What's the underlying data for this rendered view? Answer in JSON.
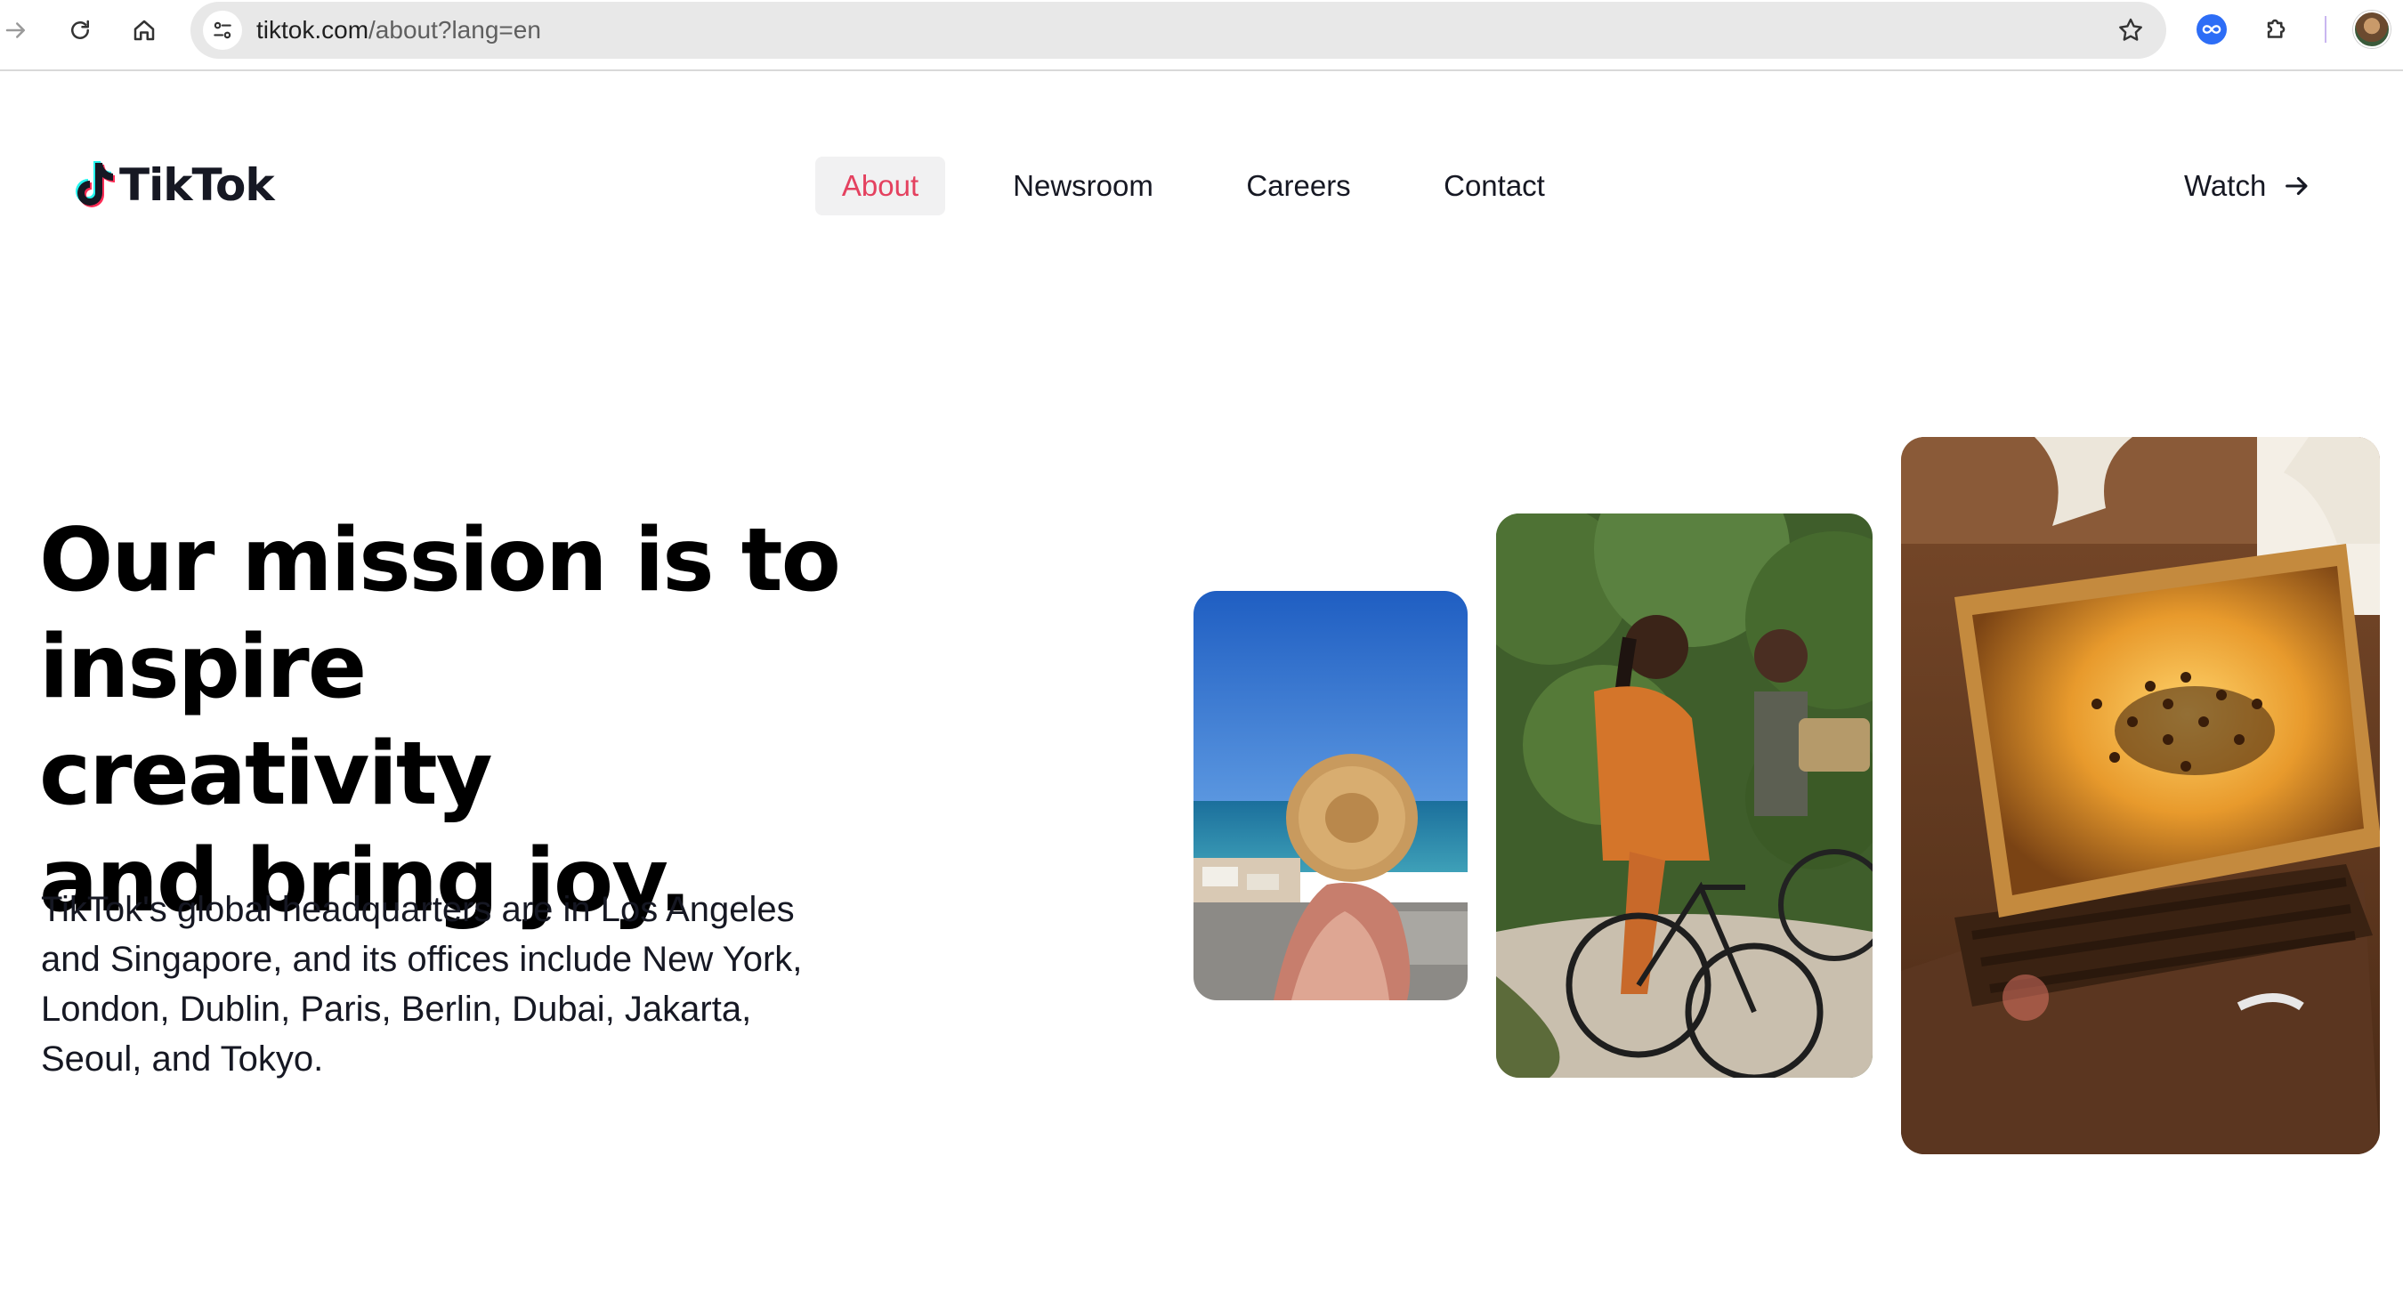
{
  "browser": {
    "url_host": "tiktok.com",
    "url_path": "/about?lang=en",
    "icons": {
      "forward": "arrow-right-icon",
      "reload": "reload-icon",
      "home": "home-icon",
      "site_info": "tune-icon",
      "bookmark": "star-icon",
      "extension": "infinity-icon",
      "extensions_menu": "puzzle-icon"
    }
  },
  "header": {
    "logo_text": "TikTok",
    "nav": [
      {
        "label": "About",
        "active": true
      },
      {
        "label": "Newsroom",
        "active": false
      },
      {
        "label": "Careers",
        "active": false
      },
      {
        "label": "Contact",
        "active": false
      }
    ],
    "watch_label": "Watch"
  },
  "hero": {
    "title_line1": "Our mission is to",
    "title_line2": "inspire creativity",
    "title_line3": "and bring joy.",
    "body_line1": "TikTok's global headquarters are in Los Angeles",
    "body_line2": "and Singapore, and its offices include New York,",
    "body_line3": "London, Dublin, Paris, Berlin, Dubai, Jakarta,",
    "body_line4": "Seoul, and Tokyo."
  },
  "colors": {
    "brand_red": "#e4415f",
    "brand_cyan": "#25f4ee",
    "text": "#161823",
    "active_bg": "#f1f1f2"
  }
}
